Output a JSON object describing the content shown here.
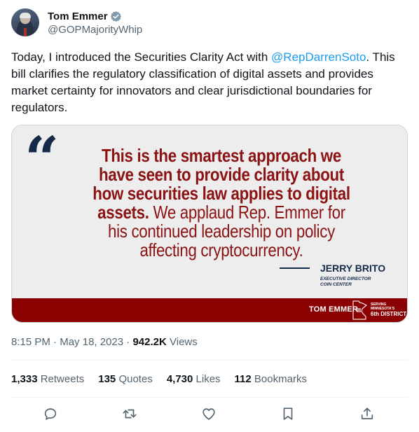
{
  "author": {
    "display_name": "Tom Emmer",
    "handle": "@GOPMajorityWhip",
    "verified_icon": "verified-badge-icon"
  },
  "tweet": {
    "text_before": "Today, I introduced the Securities Clarity Act with ",
    "mention": "@RepDarrenSoto",
    "text_after": ". This bill clarifies the regulatory classification of digital assets and provides market certainty for innovators and clear jurisdictional boundaries for regulators."
  },
  "media": {
    "quote_mark": "“",
    "quote_bold": "This is the smartest approach we have seen to provide clarity about how securities law applies to digital assets.",
    "quote_regular": " We applaud Rep. Emmer for his continued leadership on policy affecting cryptocurrency.",
    "attribution_name": "JERRY BRITO",
    "attribution_title_1": "EXECUTIVE DIRECTOR",
    "attribution_title_2": "COIN CENTER",
    "banner_name": "TOM EMMER",
    "banner_district_line1": "SERVING MINNESOTA'S",
    "banner_district_line2": "6th DISTRICT",
    "colors": {
      "quote": "#8b1313",
      "navy": "#152a48",
      "banner": "#8b0000"
    }
  },
  "meta": {
    "time": "8:15 PM",
    "sep1": " · ",
    "date": "May 18, 2023",
    "sep2": " · ",
    "views_count": "942.2K",
    "views_label": " Views"
  },
  "stats": [
    {
      "count": "1,333",
      "label": " Retweets"
    },
    {
      "count": "135",
      "label": " Quotes"
    },
    {
      "count": "4,730",
      "label": " Likes"
    },
    {
      "count": "112",
      "label": " Bookmarks"
    }
  ],
  "actions": [
    "reply-icon",
    "retweet-icon",
    "like-icon",
    "bookmark-icon",
    "share-icon"
  ],
  "colors": {
    "accent": "#1d9bf0",
    "secondary_text": "#536471",
    "primary_text": "#0f1419"
  }
}
